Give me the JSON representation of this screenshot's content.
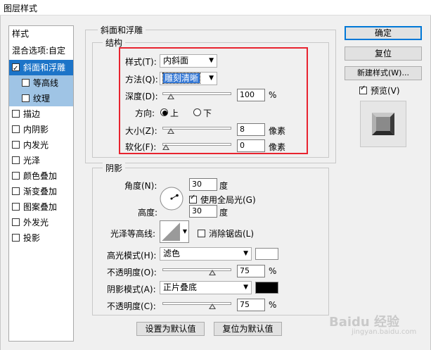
{
  "window": {
    "title": "图层样式"
  },
  "panel": {
    "items": [
      {
        "label": "样式",
        "checkbox": false
      },
      {
        "label": "混合选项:自定",
        "checkbox": false
      },
      {
        "label": "斜面和浮雕",
        "checkbox": true,
        "checked": true
      },
      {
        "label": "等高线",
        "checkbox": true,
        "checked": false
      },
      {
        "label": "纹理",
        "checkbox": true,
        "checked": false
      },
      {
        "label": "描边",
        "checkbox": true,
        "checked": false
      },
      {
        "label": "内阴影",
        "checkbox": true,
        "checked": false
      },
      {
        "label": "内发光",
        "checkbox": true,
        "checked": false
      },
      {
        "label": "光泽",
        "checkbox": true,
        "checked": false
      },
      {
        "label": "颜色叠加",
        "checkbox": true,
        "checked": false
      },
      {
        "label": "渐变叠加",
        "checkbox": true,
        "checked": false
      },
      {
        "label": "图案叠加",
        "checkbox": true,
        "checked": false
      },
      {
        "label": "外发光",
        "checkbox": true,
        "checked": false
      },
      {
        "label": "投影",
        "checkbox": true,
        "checked": false
      }
    ]
  },
  "bevel": {
    "group_title": "斜面和浮雕",
    "structure_title": "结构",
    "style_label": "样式(T):",
    "style_value": "内斜面",
    "technique_label": "方法(Q):",
    "technique_value": "雕刻清晰",
    "depth_label": "深度(D):",
    "depth_value": "100",
    "depth_unit": "%",
    "depth_level": 0.08,
    "direction_label": "方向:",
    "direction_up": "上",
    "direction_down": "下",
    "size_label": "大小(Z):",
    "size_value": "8",
    "size_unit": "像素",
    "size_level": 0.08,
    "soften_label": "软化(F):",
    "soften_value": "0",
    "soften_unit": "像素",
    "soften_level": 0.0
  },
  "shading": {
    "title": "阴影",
    "angle_label": "角度(N):",
    "angle_value": "30",
    "angle_unit": "度",
    "global_light_label": "使用全局光(G)",
    "global_light_checked": true,
    "altitude_label": "高度:",
    "altitude_value": "30",
    "altitude_unit": "度",
    "gloss_label": "光泽等高线:",
    "antialias_label": "消除锯齿(L)",
    "antialias_checked": false,
    "highlight_mode_label": "高光模式(H):",
    "highlight_mode_value": "滤色",
    "highlight_color": "#ffffff",
    "highlight_opacity_label": "不透明度(O):",
    "highlight_opacity_value": "75",
    "highlight_opacity_unit": "%",
    "highlight_opacity_level": 0.75,
    "shadow_mode_label": "阴影模式(A):",
    "shadow_mode_value": "正片叠底",
    "shadow_color": "#000000",
    "shadow_opacity_label": "不透明度(C):",
    "shadow_opacity_value": "75",
    "shadow_opacity_unit": "%",
    "shadow_opacity_level": 0.75
  },
  "footer": {
    "make_default": "设置为默认值",
    "reset_default": "复位为默认值"
  },
  "buttons": {
    "ok": "确定",
    "reset": "复位",
    "new_style": "新建样式(W)...",
    "preview_label": "预览(V)",
    "preview_checked": true
  },
  "colors": {
    "selection": "#1c74c8",
    "highlight_box": "#e8232f"
  },
  "watermark": {
    "text": "Baidu 经验",
    "sub": "jingyan.baidu.com"
  }
}
